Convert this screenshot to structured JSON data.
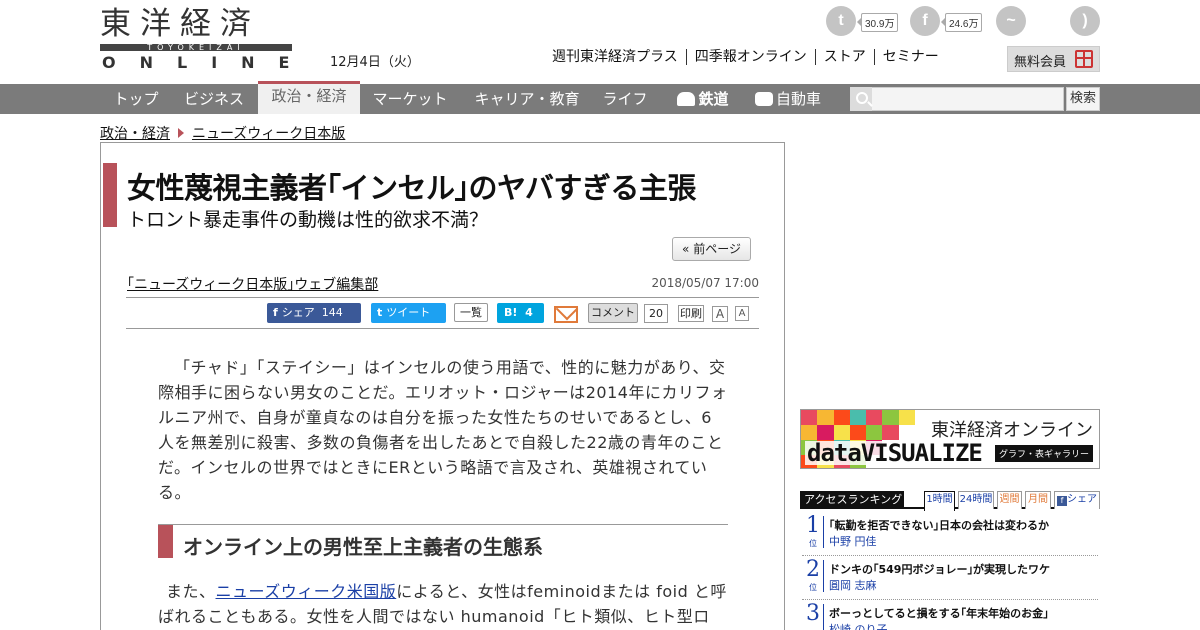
{
  "header": {
    "logo_jp": "東洋経済",
    "logo_sub": "TOYOKEIZAI",
    "logo_en": "ONLINE",
    "date": "12月4日（火）",
    "social": {
      "twitter_count": "30.9万",
      "facebook_count": "24.6万"
    },
    "links": [
      "週刊東洋経済プラス",
      "四季報オンライン",
      "ストア",
      "セミナー"
    ],
    "member_button": "無料会員"
  },
  "nav": {
    "items": [
      "トップ",
      "ビジネス",
      "政治・経済",
      "マーケット",
      "キャリア・教育",
      "ライフ",
      "鉄道",
      "自動車"
    ],
    "active": "政治・経済",
    "search_button": "検索"
  },
  "breadcrumb": [
    "政治・経済",
    "ニューズウィーク日本版"
  ],
  "article": {
    "title": "女性蔑視主義者｢インセル｣のヤバすぎる主張",
    "subtitle": "トロント暴走事件の動機は性的欲求不満？",
    "prev_page": "« 前ページ",
    "author": "｢ニューズウィーク日本版｣ウェブ編集部",
    "timestamp": "2018/05/07 17:00",
    "share": {
      "facebook": "シェア",
      "facebook_count": "144",
      "twitter": "ツイート",
      "list": "一覧",
      "hatena": "B!",
      "hatena_count": "4",
      "comment": "コメント",
      "comment_count": "20",
      "print": "印刷",
      "font_big": "A",
      "font_small": "A"
    },
    "paragraph1": "「チャド」「ステイシー」はインセルの使う用語で、性的に魅力があり、交際相手に困らない男女のことだ。エリオット・ロジャーは2014年にカリフォルニア州で、自身が童貞なのは自分を振った女性たちのせいであるとし、6人を無差別に殺害、多数の負傷者を出したあとで自殺した22歳の青年のことだ。インセルの世界ではときにERという略語で言及され、英雄視されている。",
    "section_heading": "オンライン上の男性至上主義者の生態系",
    "paragraph2_pre": "また、",
    "paragraph2_link": "ニューズウィーク米国版",
    "paragraph2_post": "によると、女性はfeminoidまたは foid と呼ばれることもある。女性を人間ではない humanoid「ヒト類似、ヒト型ロ"
  },
  "sidebar": {
    "banner_jp": "東洋経済オンライン",
    "banner_en": "dataVISUALIZE",
    "banner_tag": "グラフ・表ギャラリー",
    "ranking_title": "アクセスランキング",
    "ranking_tabs": [
      "1時間",
      "24時間",
      "週間",
      "月間",
      "シェア"
    ],
    "ranking_unit": "位",
    "ranking": [
      {
        "rank": "1",
        "headline": "｢転勤を拒否できない｣日本の会社は変わるか",
        "author": "中野 円佳"
      },
      {
        "rank": "2",
        "headline": "ドンキの｢549円ボジョレー｣が実現したワケ",
        "author": "圓岡 志麻"
      },
      {
        "rank": "3",
        "headline": "ボーっとしてると損をする｢年末年始のお金｣",
        "author": "松崎 のり子"
      }
    ]
  },
  "colors": {
    "accent": "#b8525a",
    "nav_bg": "#7b7b7b",
    "link": "#1a3fa6"
  }
}
